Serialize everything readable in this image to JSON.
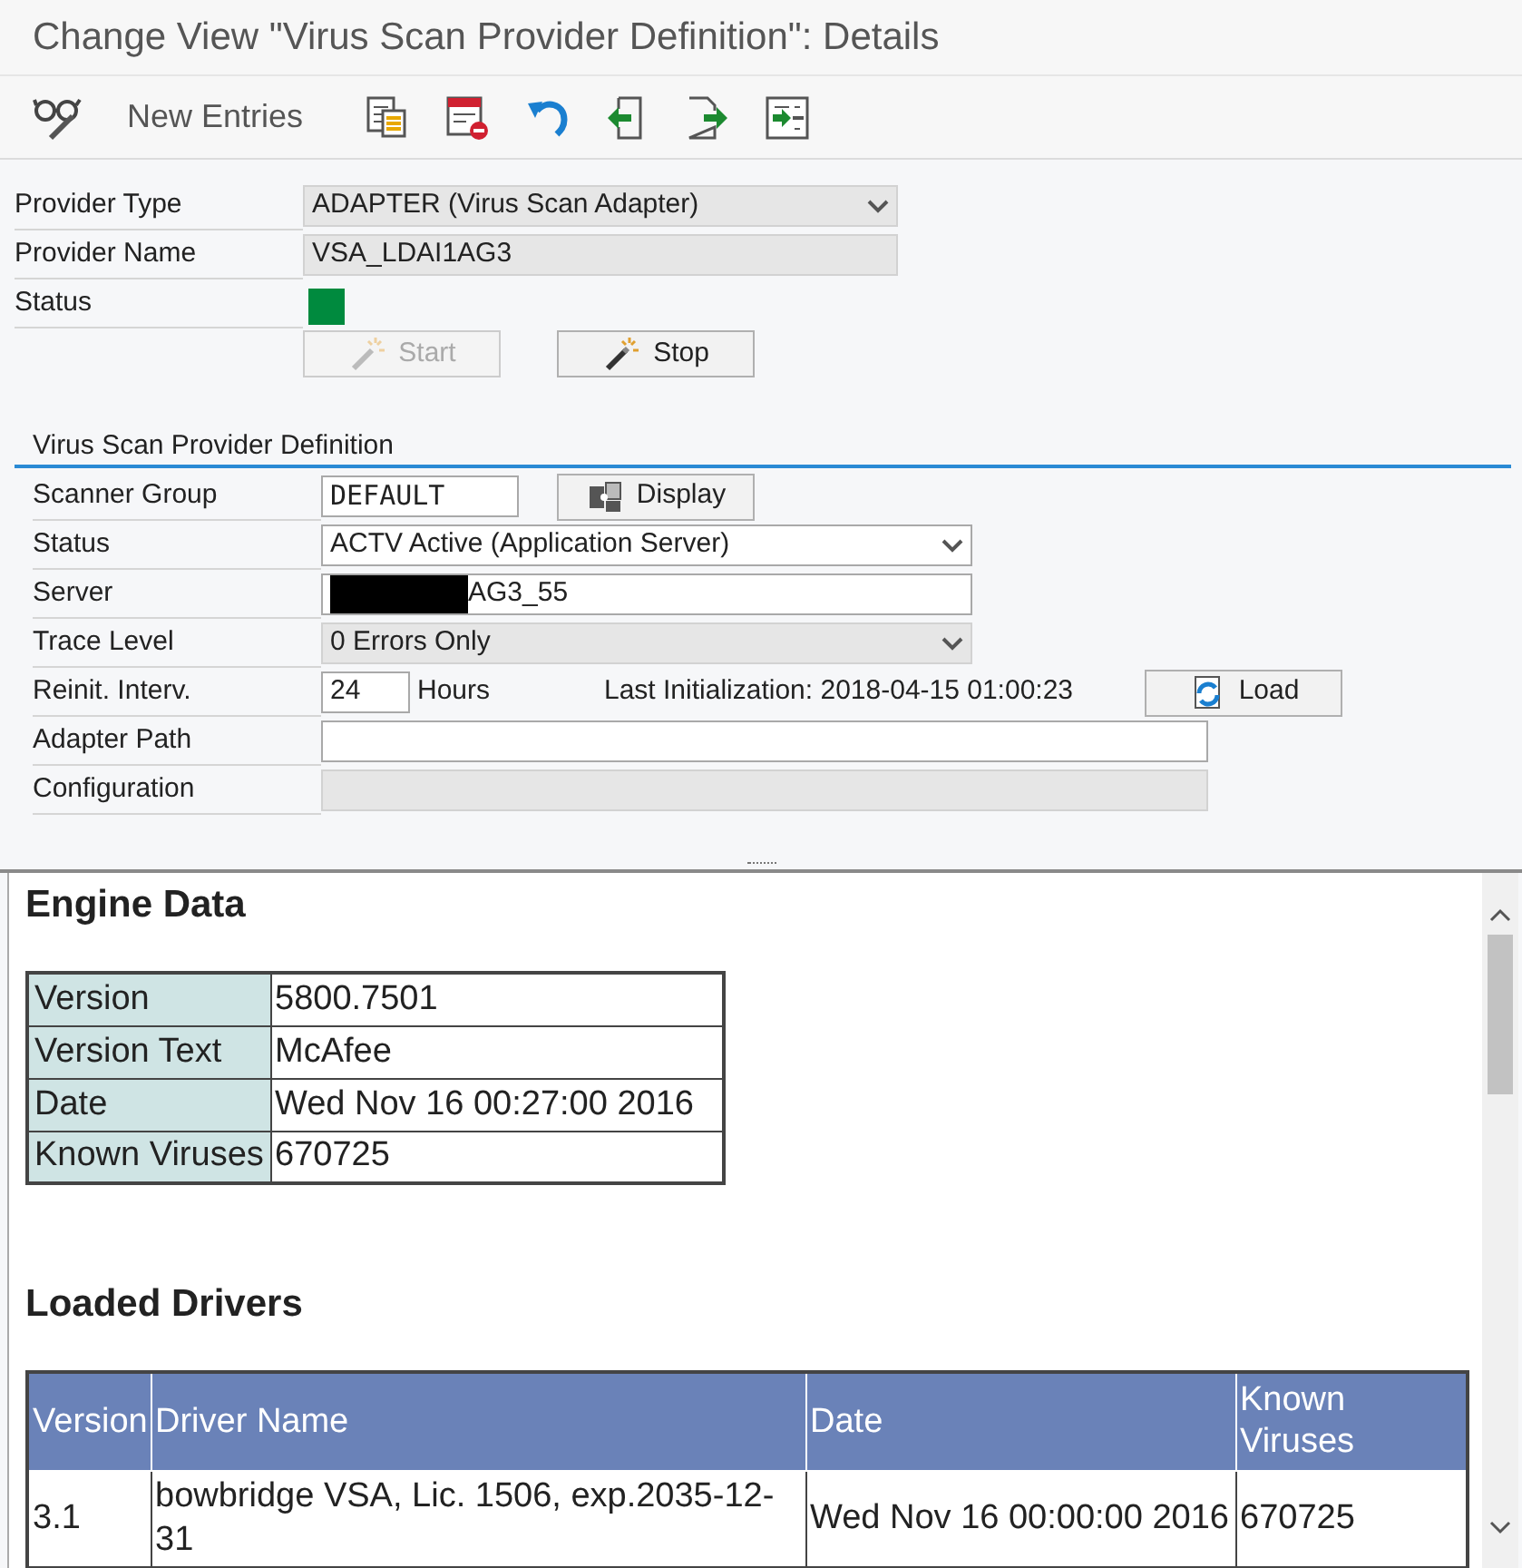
{
  "window": {
    "title": "Change View \"Virus Scan Provider Definition\": Details"
  },
  "toolbar": {
    "button_label": "New Entries"
  },
  "header_fields": [
    {
      "label": "Provider Type",
      "kind": "dropdown",
      "disabled": true,
      "value": "ADAPTER (Virus Scan Adapter)"
    },
    {
      "label": "Provider Name",
      "kind": "input",
      "disabled": true,
      "value": "VSA_LDAI1AG3"
    },
    {
      "label": "Status",
      "kind": "status",
      "color": "#008a3e"
    }
  ],
  "actions": [
    {
      "label": "Start",
      "disabled": true
    },
    {
      "label": "Stop",
      "disabled": false
    }
  ],
  "group": {
    "title": "Virus Scan Provider Definition",
    "rows": [
      {
        "label": "Scanner Group",
        "kind": "code",
        "value": "DEFAULT",
        "button": "Display"
      },
      {
        "label": "Status",
        "kind": "dropdown",
        "disabled": false,
        "value": "ACTV Active (Application Server)"
      },
      {
        "label": "Server",
        "kind": "input",
        "disabled": false,
        "redacted": true,
        "value": "AG3_55"
      },
      {
        "label": "Trace Level",
        "kind": "dropdown",
        "disabled": true,
        "value": "0 Errors Only"
      },
      {
        "label": "Reinit. Interv.",
        "kind": "interval",
        "value": "24",
        "unit": "Hours",
        "info": "Last Initialization: 2018-04-15 01:00:23",
        "button": "Load"
      },
      {
        "label": "Adapter Path",
        "kind": "input",
        "disabled": false
      },
      {
        "label": "Configuration",
        "kind": "input",
        "disabled": true
      }
    ]
  },
  "engine": {
    "title": "Engine Data",
    "rows": [
      {
        "label": "Version",
        "value": "5800.7501"
      },
      {
        "label": "Version Text",
        "value": "McAfee"
      },
      {
        "label": "Date",
        "value": "Wed Nov 16 00:27:00 2016"
      },
      {
        "label": "Known Viruses",
        "value": "670725"
      }
    ]
  },
  "drivers": {
    "title": "Loaded Drivers",
    "columns": [
      "Version",
      "Driver Name",
      "Date",
      "Known Viruses"
    ],
    "rows": [
      [
        "3.1",
        "bowbridge VSA, Lic. 1506, exp.2035-12-31",
        "Wed Nov 16 00:00:00 2016",
        "670725"
      ]
    ]
  }
}
